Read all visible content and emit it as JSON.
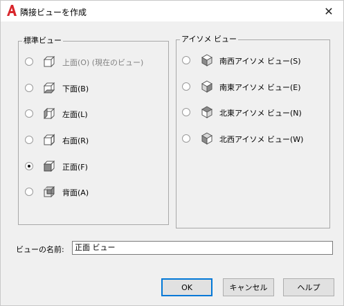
{
  "window": {
    "title": "隣接ビューを作成",
    "app_icon": "autocad-a-icon",
    "close_glyph": "✕"
  },
  "standard_views": {
    "legend": "標準ビュー",
    "items": [
      {
        "label": "上面(O) (現在のビュー)",
        "checked": false,
        "disabled": true,
        "icon": "top-view-cube-icon"
      },
      {
        "label": "下面(B)",
        "checked": false,
        "disabled": false,
        "icon": "bottom-view-cube-icon"
      },
      {
        "label": "左面(L)",
        "checked": false,
        "disabled": false,
        "icon": "left-view-cube-icon"
      },
      {
        "label": "右面(R)",
        "checked": false,
        "disabled": false,
        "icon": "right-view-cube-icon"
      },
      {
        "label": "正面(F)",
        "checked": true,
        "disabled": false,
        "icon": "front-view-cube-icon"
      },
      {
        "label": "背面(A)",
        "checked": false,
        "disabled": false,
        "icon": "back-view-cube-icon"
      }
    ]
  },
  "iso_views": {
    "legend": "アイソメ ビュー",
    "items": [
      {
        "label": "南西アイソメ ビュー(S)",
        "checked": false,
        "icon": "sw-iso-cube-icon"
      },
      {
        "label": "南東アイソメ ビュー(E)",
        "checked": false,
        "icon": "se-iso-cube-icon"
      },
      {
        "label": "北東アイソメ ビュー(N)",
        "checked": false,
        "icon": "ne-iso-cube-icon"
      },
      {
        "label": "北西アイソメ ビュー(W)",
        "checked": false,
        "icon": "nw-iso-cube-icon"
      }
    ]
  },
  "view_name": {
    "label": "ビューの名前:",
    "value": "正面 ビュー"
  },
  "buttons": {
    "ok": "OK",
    "cancel": "キャンセル",
    "help": "ヘルプ"
  },
  "colors": {
    "accent": "#0078d7",
    "app_icon_red": "#d8262c"
  }
}
